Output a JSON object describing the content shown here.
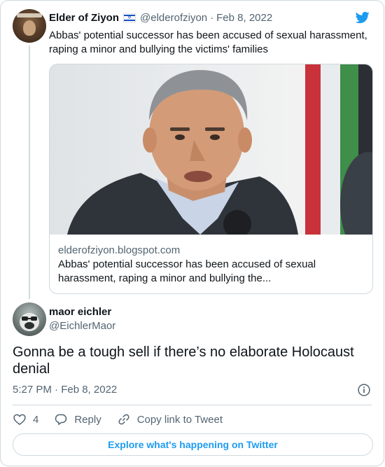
{
  "parent_tweet": {
    "author_name": "Elder of Ziyon",
    "author_handle": "@elderofziyon",
    "separator": "·",
    "date": "Feb 8, 2022",
    "text": "Abbas' potential successor has been accused of sexual harassment, raping a minor and bullying the victims' families",
    "link_card": {
      "domain": "elderofziyon.blogspot.com",
      "title": "Abbas' potential successor has been accused of sexual harassment, raping a minor and bullying the..."
    }
  },
  "main_tweet": {
    "author_name": "maor eichler",
    "author_handle": "@EichlerMaor",
    "text": "Gonna be a tough sell if there’s no elaborate Holocaust denial",
    "timestamp": "5:27 PM · Feb 8, 2022"
  },
  "actions": {
    "like_count": "4",
    "reply_label": "Reply",
    "copy_link_label": "Copy link to Tweet"
  },
  "explore_label": "Explore what's happening on Twitter",
  "colors": {
    "accent": "#1d9bf0",
    "text_primary": "#0f1419",
    "text_secondary": "#536471",
    "border": "#cfd9de"
  },
  "icons": [
    "twitter-bird-icon",
    "israel-flag-icon",
    "info-icon",
    "heart-icon",
    "reply-icon",
    "link-icon"
  ]
}
